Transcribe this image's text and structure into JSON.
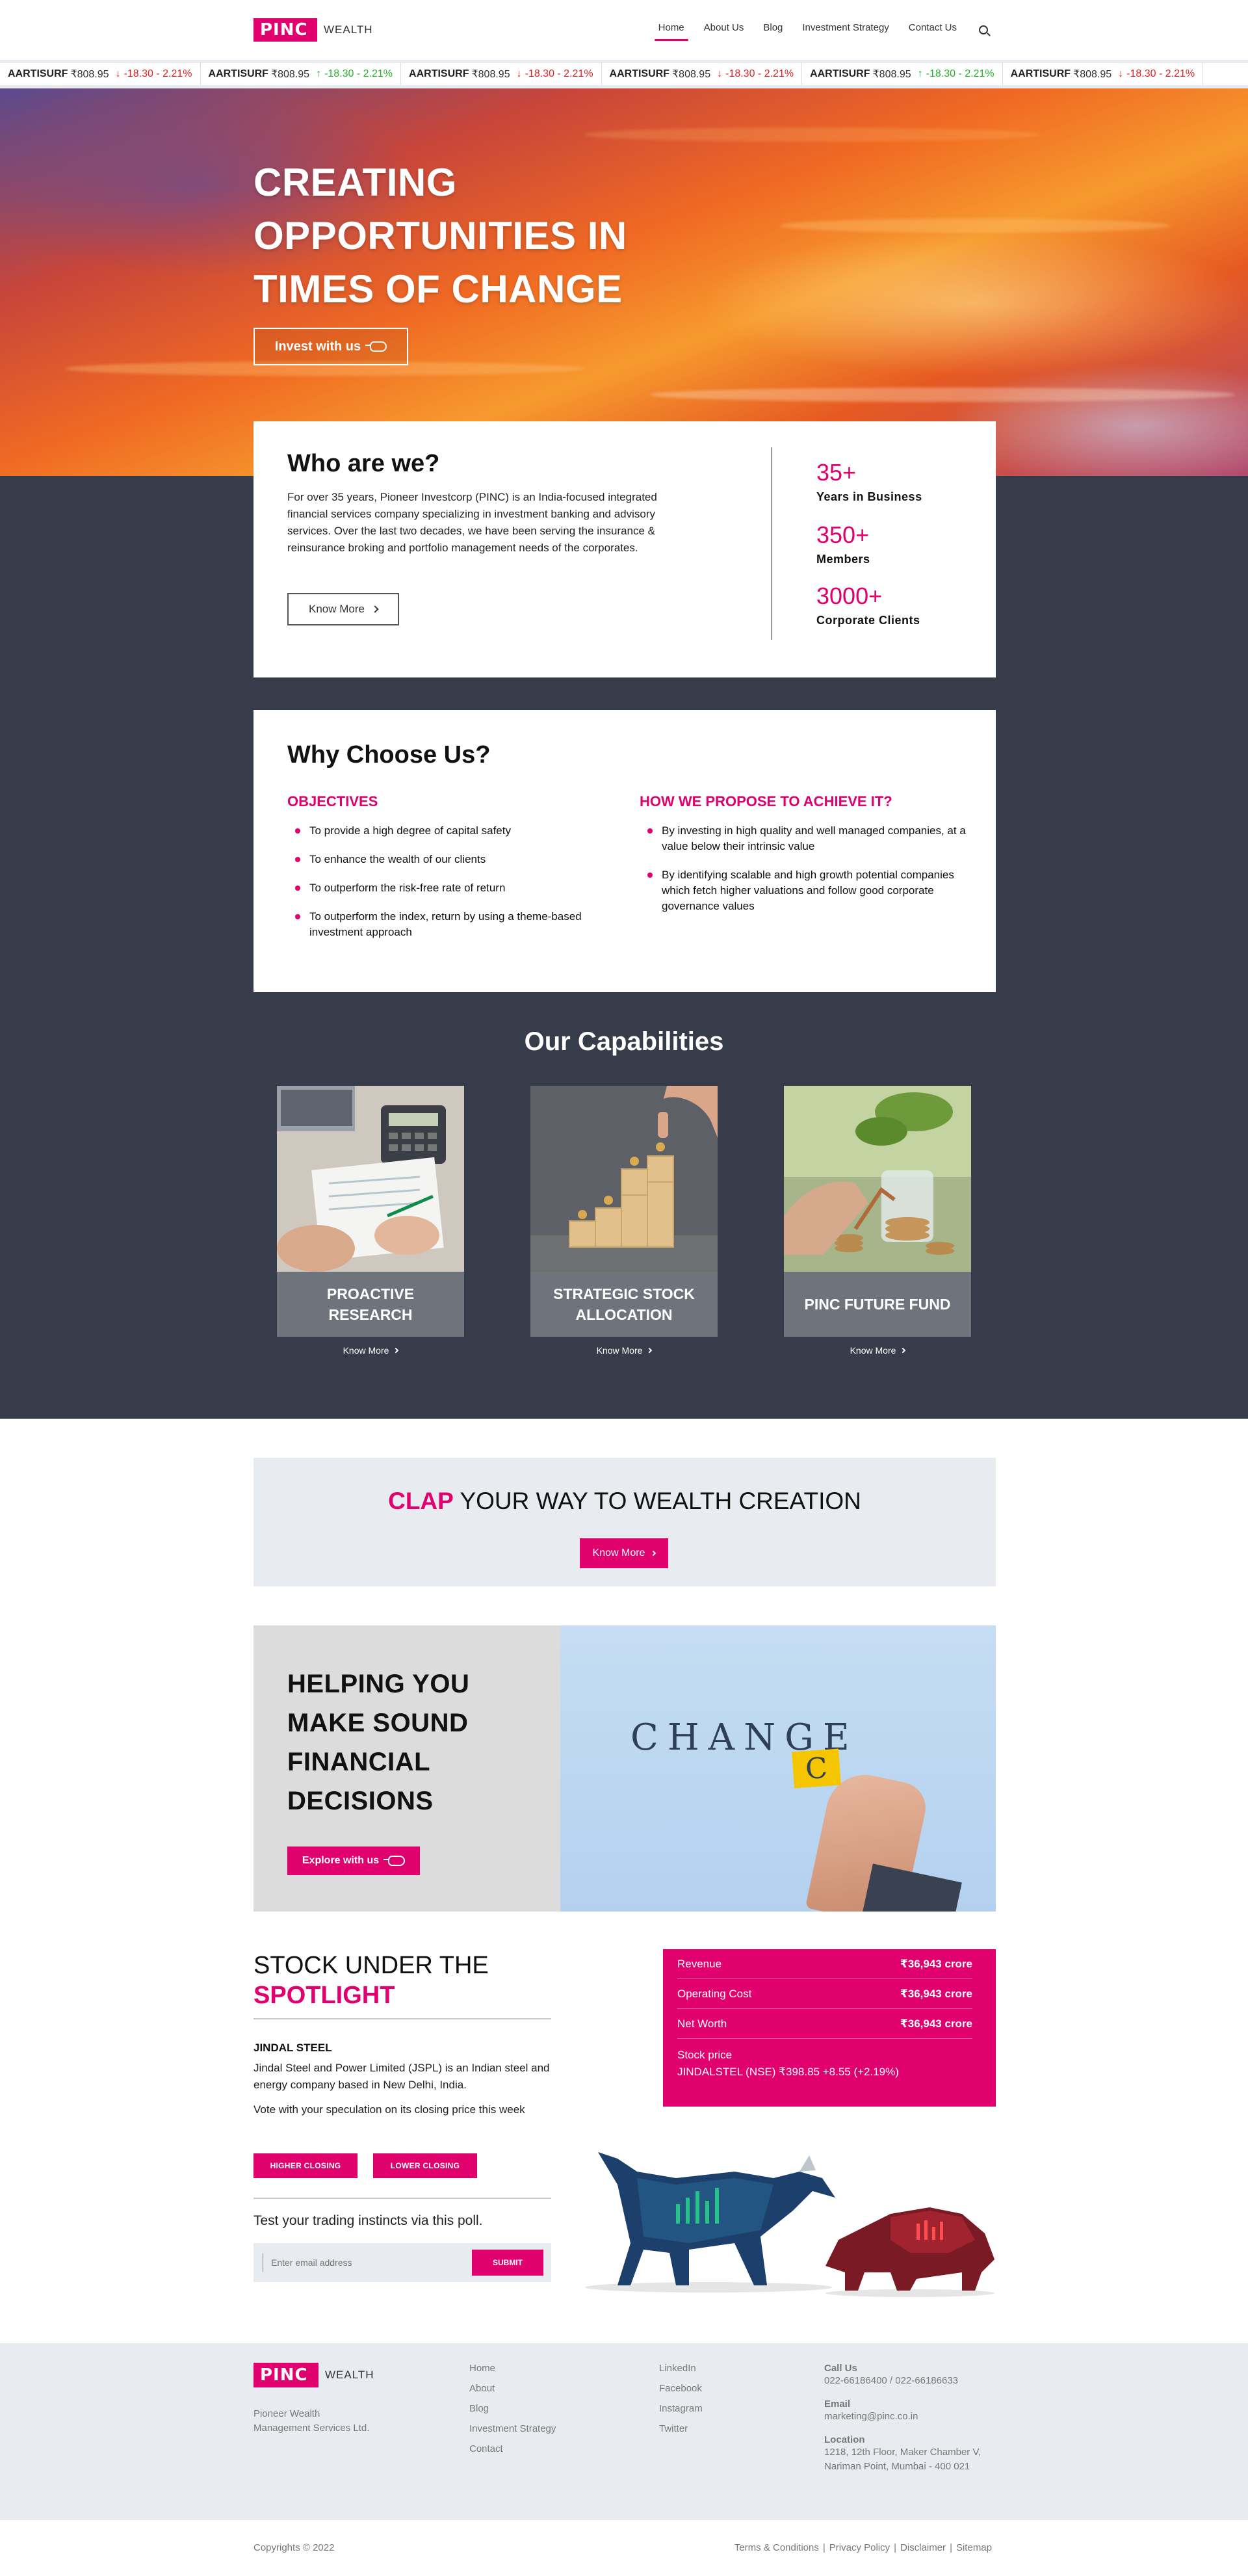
{
  "brand": {
    "logo_text": "PINC",
    "logo_suffix": "WEALTH",
    "accent": "#e0006e",
    "dark_bg": "#363c4a"
  },
  "nav": {
    "items": [
      "Home",
      "About Us",
      "Blog",
      "Investment Strategy",
      "Contact Us"
    ],
    "active": "Home",
    "search_icon": "search-icon"
  },
  "ticker": [
    {
      "symbol": "AARTISURF",
      "price": "₹808.95",
      "change": "-18.30 - 2.21%",
      "direction": "down"
    },
    {
      "symbol": "AARTISURF",
      "price": "₹808.95",
      "change": "-18.30 - 2.21%",
      "direction": "up"
    },
    {
      "symbol": "AARTISURF",
      "price": "₹808.95",
      "change": "-18.30 - 2.21%",
      "direction": "down"
    },
    {
      "symbol": "AARTISURF",
      "price": "₹808.95",
      "change": "-18.30 - 2.21%",
      "direction": "down"
    },
    {
      "symbol": "AARTISURF",
      "price": "₹808.95",
      "change": "-18.30 - 2.21%",
      "direction": "up"
    },
    {
      "symbol": "AARTISURF",
      "price": "₹808.95",
      "change": "-18.30 - 2.21%",
      "direction": "down"
    }
  ],
  "hero": {
    "title": "CREATING OPPORTUNITIES IN TIMES OF CHANGE",
    "button": "Invest with us"
  },
  "who": {
    "title": "Who are we?",
    "text": "For over 35 years, Pioneer Investcorp (PINC) is an India-focused integrated financial services company specializing in investment banking and advisory services. Over the last two decades, we have been serving the insurance & reinsurance broking and portfolio management needs of the corporates.",
    "button": "Know More",
    "stats": [
      {
        "value": "35+",
        "label": "Years in Business"
      },
      {
        "value": "350+",
        "label": "Members"
      },
      {
        "value": "3000+",
        "label": "Corporate Clients"
      }
    ]
  },
  "why": {
    "title": "Why Choose Us?",
    "objectives_heading": "OBJECTIVES",
    "objectives": [
      "To provide a high degree of capital safety",
      "To enhance the wealth of our clients",
      "To outperform the risk-free rate of return",
      "To outperform the index, return by using a theme-based investment approach"
    ],
    "approach_heading": "HOW WE PROPOSE TO ACHIEVE IT?",
    "approach": [
      "By investing in high quality and well managed companies, at a value below their intrinsic value",
      "By identifying scalable and high growth potential companies which fetch higher valuations and follow good corporate governance values"
    ]
  },
  "capabilities": {
    "title": "Our Capabilities",
    "items": [
      {
        "label": "PROACTIVE RESEARCH",
        "link": "Know More"
      },
      {
        "label": "STRATEGIC STOCK ALLOCATION",
        "link": "Know More"
      },
      {
        "label": "PINC FUTURE FUND",
        "link": "Know More"
      }
    ]
  },
  "clap": {
    "highlight": "CLAP",
    "rest": " YOUR WAY TO WEALTH CREATION",
    "button": "Know More"
  },
  "helping": {
    "title": "HELPING YOU MAKE SOUND FINANCIAL DECISIONS",
    "button": "Explore with us",
    "image_word": "CHANGE",
    "image_note": "C"
  },
  "stock": {
    "title_line1": "STOCK UNDER THE",
    "title_line2": "SPOTLIGHT",
    "name": "JINDAL STEEL",
    "description": "Jindal Steel and Power Limited (JSPL) is an Indian steel and energy company based in New Delhi, India.",
    "vote_text": "Vote with your speculation on its closing price this week",
    "higher_button": "HIGHER CLOSING",
    "lower_button": "LOWER CLOSING",
    "poll_text": "Test your trading instincts via this poll.",
    "email_placeholder": "Enter email address",
    "submit": "SUBMIT",
    "financials": [
      {
        "label": "Revenue",
        "value": "₹36,943 crore"
      },
      {
        "label": "Operating Cost",
        "value": "₹36,943 crore"
      },
      {
        "label": "Net Worth",
        "value": "₹36,943 crore"
      }
    ],
    "price_label": "Stock price",
    "price_value": "JINDALSTEL (NSE) ₹398.85 +8.55 (+2.19%)"
  },
  "footer": {
    "company": "Pioneer Wealth Management Services Ltd.",
    "links1": [
      "Home",
      "About",
      "Blog",
      "Investment Strategy",
      "Contact"
    ],
    "links2": [
      "LinkedIn",
      "Facebook",
      "Instagram",
      "Twitter"
    ],
    "call_heading": "Call Us",
    "call": "022-66186400 / 022-66186633",
    "email_heading": "Email",
    "email": "marketing@pinc.co.in",
    "location_heading": "Location",
    "location": "1218, 12th Floor, Maker Chamber V, Nariman Point, Mumbai - 400 021",
    "copyright": "Copyrights © 2022",
    "legal": [
      "Terms & Conditions",
      "Privacy Policy",
      "Disclaimer",
      "Sitemap"
    ]
  }
}
